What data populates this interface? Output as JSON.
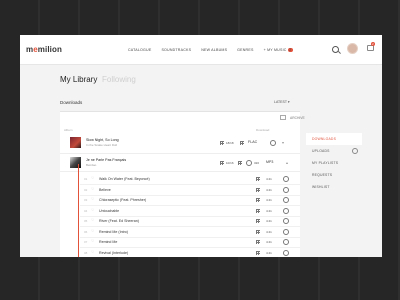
{
  "app": {
    "logo_prefix": "m",
    "logo_accent": "e",
    "logo_rest": "milion"
  },
  "nav": [
    "CATALOGUE",
    "SOUNDTRACKS",
    "NEW ALBUMS",
    "GENRES",
    "MY MUSIC"
  ],
  "notif_count": "2",
  "cart_count": "2",
  "library": {
    "title": "My Library",
    "tab2": "Following"
  },
  "downloads": {
    "label": "Downloads",
    "sort": "LATEST",
    "archive": "ARCHIVE"
  },
  "columns": {
    "album": "Album",
    "download": "Download"
  },
  "albums": [
    {
      "title": "Slow Night, So Long",
      "artist": "In the Snake Heart Doll",
      "count": "18/18",
      "format": "FLAC"
    },
    {
      "title": "Je ne Parle Pas Français",
      "artist": "Beirdao",
      "count": "10/16",
      "format": "MP3",
      "quality": "320"
    }
  ],
  "tracks": [
    {
      "num": "01",
      "name": "Walk On Water (Feat. Beyoncé)",
      "dur": "4:41"
    },
    {
      "num": "02",
      "name": "Believe",
      "dur": "4:41"
    },
    {
      "num": "03",
      "name": "Chloraseptic (Feat. Phresher)",
      "dur": "4:41"
    },
    {
      "num": "04",
      "name": "Untouchable",
      "dur": "4:41"
    },
    {
      "num": "05",
      "name": "River (Feat. Ed Sheeran)",
      "dur": "4:41"
    },
    {
      "num": "06",
      "name": "Remind Me (Intro)",
      "dur": "4:41"
    },
    {
      "num": "07",
      "name": "Remind Me",
      "dur": "4:41"
    },
    {
      "num": "08",
      "name": "Revival (Interlude)",
      "dur": "4:41"
    }
  ],
  "sidebar": [
    "DOWNLOADS",
    "UPLOADS",
    "MY PLAYLISTS",
    "REQUESTS",
    "WISHLIST"
  ],
  "colors": {
    "accent": "#e2513a"
  }
}
